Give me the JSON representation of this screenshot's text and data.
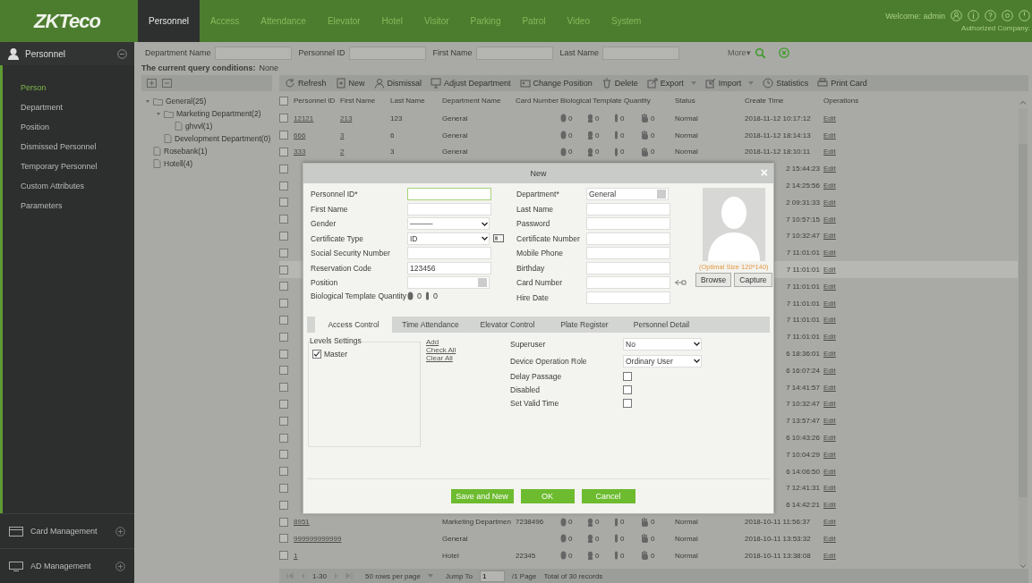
{
  "topbar": {
    "logo": "ZKTeco",
    "tabs": [
      {
        "label": "Personnel",
        "selected": true
      },
      {
        "label": "Access",
        "selected": false
      },
      {
        "label": "Attendance",
        "selected": false
      },
      {
        "label": "Elevator",
        "selected": false
      },
      {
        "label": "Hotel",
        "selected": false
      },
      {
        "label": "Visitor",
        "selected": false
      },
      {
        "label": "Parking",
        "selected": false
      },
      {
        "label": "Patrol",
        "selected": false
      },
      {
        "label": "Video",
        "selected": false
      },
      {
        "label": "System",
        "selected": false
      }
    ],
    "welcome": "Welcome: admin",
    "company": "Authorized Company:"
  },
  "sidebar": {
    "title": "Personnel",
    "items": [
      {
        "label": "Person",
        "selected": true
      },
      {
        "label": "Department",
        "selected": false
      },
      {
        "label": "Position",
        "selected": false
      },
      {
        "label": "Dismissed Personnel",
        "selected": false
      },
      {
        "label": "Temporary Personnel",
        "selected": false
      },
      {
        "label": "Custom Attributes",
        "selected": false
      },
      {
        "label": "Parameters",
        "selected": false
      }
    ],
    "sections": [
      "Card Management",
      "AD Management"
    ]
  },
  "search": {
    "fields": [
      "Department Name",
      "Personnel ID",
      "First Name",
      "Last Name"
    ],
    "more": "More▾"
  },
  "query": {
    "label": "The current query conditions:",
    "value": "None"
  },
  "tree": [
    {
      "label": "General(25)",
      "expanded": true,
      "children": [
        {
          "label": "Marketing Department(2)",
          "expanded": true,
          "children": [
            {
              "label": "ghvvl(1)"
            }
          ]
        },
        {
          "label": "Development Department(0)"
        }
      ]
    },
    {
      "label": "Rosebank(1)"
    },
    {
      "label": "Hotell(4)"
    }
  ],
  "toolbar": [
    {
      "label": "Refresh",
      "dropdown": false
    },
    {
      "label": "New",
      "dropdown": false
    },
    {
      "label": "Dismissal",
      "dropdown": false
    },
    {
      "label": "Adjust Department",
      "dropdown": false
    },
    {
      "label": "Change Position",
      "dropdown": false
    },
    {
      "label": "Delete",
      "dropdown": false
    },
    {
      "label": "Export",
      "dropdown": true
    },
    {
      "label": "Import",
      "dropdown": true
    },
    {
      "label": "Statistics",
      "dropdown": false
    },
    {
      "label": "Print Card",
      "dropdown": false
    }
  ],
  "table": {
    "select_all": {
      "checked": false
    },
    "columns": [
      "Personnel ID",
      "First Name",
      "Last Name",
      "Department Name",
      "Card Number",
      "Biological Template Quantity",
      "Status",
      "Create Time",
      "Operations"
    ],
    "rows": [
      {
        "kind": "full",
        "checked": false,
        "selected": false,
        "id": "12121",
        "first": "213",
        "last": "123",
        "dept": "General",
        "bio": [
          "0",
          "0",
          "0",
          "0"
        ],
        "status": "Normal",
        "time": "2018-11-12 10:17:12",
        "op": "Edit"
      },
      {
        "kind": "full",
        "checked": false,
        "selected": false,
        "id": "666",
        "first": "3",
        "last": "6",
        "dept": "General",
        "bio": [
          "0",
          "0",
          "0",
          "0"
        ],
        "status": "Normal",
        "time": "2018-11-12 18:14:13",
        "op": "Edit"
      },
      {
        "kind": "full",
        "checked": false,
        "selected": false,
        "id": "333",
        "first": "2",
        "last": "3",
        "dept": "General",
        "bio": [
          "0",
          "0",
          "0",
          "0"
        ],
        "status": "Normal",
        "time": "2018-11-12 18:10:11",
        "op": "Edit"
      },
      {
        "kind": "partial",
        "checked": false,
        "selected": false,
        "time": "2 15:44:23",
        "op": "Edit"
      },
      {
        "kind": "partial",
        "checked": false,
        "selected": false,
        "time": "2 14:25:56",
        "op": "Edit"
      },
      {
        "kind": "partial",
        "checked": false,
        "selected": false,
        "time": "2 09:31:33",
        "op": "Edit"
      },
      {
        "kind": "partial",
        "checked": false,
        "selected": false,
        "time": "7 10:57:15",
        "op": "Edit"
      },
      {
        "kind": "partial",
        "checked": false,
        "selected": false,
        "time": "7 10:32:47",
        "op": "Edit"
      },
      {
        "kind": "partial",
        "checked": false,
        "selected": false,
        "time": "7 11:01:01",
        "op": "Edit"
      },
      {
        "kind": "partial",
        "checked": false,
        "selected": true,
        "time": "7 11:01:01",
        "op": "Edit"
      },
      {
        "kind": "partial",
        "checked": false,
        "selected": false,
        "time": "7 11:01:01",
        "op": "Edit"
      },
      {
        "kind": "partial",
        "checked": false,
        "selected": false,
        "time": "7 11:01:01",
        "op": "Edit"
      },
      {
        "kind": "partial",
        "checked": false,
        "selected": false,
        "time": "7 11:01:01",
        "op": "Edit"
      },
      {
        "kind": "partial",
        "checked": false,
        "selected": false,
        "time": "7 11:01:01",
        "op": "Edit"
      },
      {
        "kind": "partial",
        "checked": false,
        "selected": false,
        "time": "6 18:36:01",
        "op": "Edit"
      },
      {
        "kind": "partial",
        "checked": false,
        "selected": false,
        "time": "6 16:07:24",
        "op": "Edit"
      },
      {
        "kind": "partial",
        "checked": false,
        "selected": false,
        "time": "7 14:41:57",
        "op": "Edit"
      },
      {
        "kind": "partial",
        "checked": false,
        "selected": false,
        "time": "7 10:32:47",
        "op": "Edit"
      },
      {
        "kind": "partial",
        "checked": false,
        "selected": false,
        "time": "7 13:57:47",
        "op": "Edit"
      },
      {
        "kind": "partial",
        "checked": false,
        "selected": false,
        "time": "6 10:43:26",
        "op": "Edit"
      },
      {
        "kind": "partial",
        "checked": false,
        "selected": false,
        "time": "7 10:04:29",
        "op": "Edit"
      },
      {
        "kind": "partial",
        "checked": false,
        "selected": false,
        "time": "6 14:06:50",
        "op": "Edit"
      },
      {
        "kind": "partial",
        "checked": false,
        "selected": false,
        "time": "7 12:41:31",
        "op": "Edit"
      },
      {
        "kind": "partial",
        "checked": false,
        "selected": false,
        "time": "6 14:42:21",
        "op": "Edit"
      },
      {
        "kind": "full",
        "checked": false,
        "selected": false,
        "id": "8951",
        "dept": "Marketing Departmen",
        "card": "7238496",
        "bio": [
          "0",
          "0",
          "0",
          "0"
        ],
        "status": "Normal",
        "time": "2018-10-11 11:56:37",
        "op": "Edit"
      },
      {
        "kind": "full",
        "checked": false,
        "selected": false,
        "id": "999999999999",
        "dept": "General",
        "bio": [
          "0",
          "0",
          "0",
          "0"
        ],
        "status": "Normal",
        "time": "2018-10-11 13:53:32",
        "op": "Edit"
      },
      {
        "kind": "full",
        "checked": false,
        "selected": false,
        "id": "1",
        "dept": "Hotel",
        "card": "22345",
        "bio": [
          "0",
          "0",
          "0",
          "0"
        ],
        "status": "Normal",
        "time": "2018-10-11 13:38:08",
        "op": "Edit"
      }
    ]
  },
  "pagination": {
    "range": "1-30",
    "per_page": "50 rows per page",
    "jump_label": "Jump To",
    "jump_value": "1",
    "pages": "/1 Page",
    "total": "Total of 30 records"
  },
  "modal": {
    "title": "New",
    "close": "×",
    "left_fields": [
      {
        "label": "Personnel ID*",
        "kind": "text",
        "focused": true
      },
      {
        "label": "First Name",
        "kind": "text",
        "focused": false
      },
      {
        "label": "Gender",
        "kind": "select",
        "value": "———",
        "focused": false
      },
      {
        "label": "Certificate Type",
        "kind": "idselect",
        "value": "ID",
        "focused": false
      },
      {
        "label": "Social Security Number",
        "kind": "text",
        "focused": false
      },
      {
        "label": "Reservation Code",
        "kind": "text",
        "value": "123456",
        "focused": false
      },
      {
        "label": "Position",
        "kind": "picker",
        "focused": false
      },
      {
        "label": "Biological Template Quantity",
        "kind": "bio",
        "counts": [
          "0",
          "0"
        ]
      }
    ],
    "right_fields": [
      {
        "label": "Department*",
        "kind": "picker",
        "value": "General",
        "focused": false
      },
      {
        "label": "Last Name",
        "kind": "text",
        "focused": false
      },
      {
        "label": "Password",
        "kind": "text",
        "focused": false
      },
      {
        "label": "Certificate Number",
        "kind": "text",
        "focused": false
      },
      {
        "label": "Mobile Phone",
        "kind": "text",
        "focused": false
      },
      {
        "label": "Birthday",
        "kind": "text",
        "focused": false
      },
      {
        "label": "Card Number",
        "kind": "card",
        "focused": false
      },
      {
        "label": "Hire Date",
        "kind": "text",
        "focused": false
      }
    ],
    "photo": {
      "hint": "(Optimal Size 120*140)",
      "buttons": [
        "Browse",
        "Capture"
      ]
    },
    "tabs": [
      {
        "label": "Access Control",
        "selected": true
      },
      {
        "label": "Time Attendance",
        "selected": false
      },
      {
        "label": "Elevator Control",
        "selected": false
      },
      {
        "label": "Plate Register",
        "selected": false
      },
      {
        "label": "Personnel Detail",
        "selected": false
      }
    ],
    "levels": {
      "title": "Levels Settings",
      "items": [
        {
          "label": "Master",
          "checked": true
        }
      ],
      "links": [
        "Add",
        "Check All",
        "Clear All"
      ]
    },
    "options": [
      {
        "label": "Superuser",
        "kind": "select",
        "value": "No"
      },
      {
        "label": "Device Operation Role",
        "kind": "select",
        "value": "Ordinary User"
      },
      {
        "label": "Delay Passage",
        "kind": "checkbox",
        "checked": false
      },
      {
        "label": "Disabled",
        "kind": "checkbox",
        "checked": false
      },
      {
        "label": "Set Valid Time",
        "kind": "checkbox",
        "checked": false
      }
    ],
    "buttons": [
      "Save and New",
      "OK",
      "Cancel"
    ]
  }
}
